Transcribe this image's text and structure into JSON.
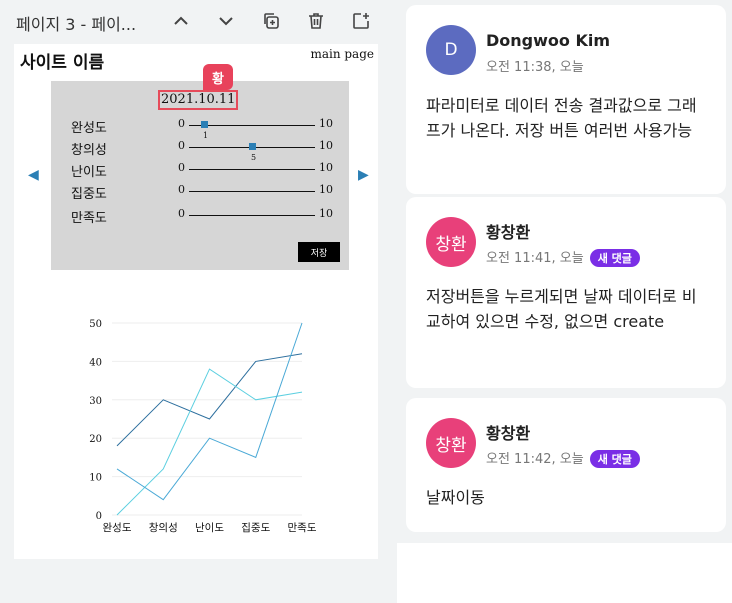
{
  "toolbar": {
    "page_title": "페이지 3 - 페이...",
    "buttons": [
      "chevron-up",
      "chevron-down",
      "duplicate-page",
      "delete-page",
      "add-page"
    ]
  },
  "wireframe": {
    "site_name": "사이트 이름",
    "main_page_link": "main page",
    "date": "2021.10.11",
    "cursor_tag": "황",
    "sliders": [
      {
        "label": "완성도",
        "min": "0",
        "max": "10",
        "value": "1"
      },
      {
        "label": "창의성",
        "min": "0",
        "max": "10",
        "value": "5"
      },
      {
        "label": "난이도",
        "min": "0",
        "max": "10",
        "value": ""
      },
      {
        "label": "집중도",
        "min": "0",
        "max": "10",
        "value": ""
      },
      {
        "label": "만족도",
        "min": "0",
        "max": "10",
        "value": ""
      }
    ],
    "save_label": "저장"
  },
  "chart_data": {
    "type": "line",
    "categories": [
      "완성도",
      "창의성",
      "난이도",
      "집중도",
      "만족도"
    ],
    "ylim": [
      0,
      50
    ],
    "yticks": [
      "0",
      "10",
      "20",
      "30",
      "40",
      "50"
    ],
    "grid": true,
    "series": [
      {
        "color": "#2d6f9e",
        "values": [
          18,
          30,
          25,
          40,
          42
        ]
      },
      {
        "color": "#5ccfe0",
        "values": [
          0,
          12,
          38,
          30,
          32
        ]
      },
      {
        "color": "#4aa9d6",
        "values": [
          12,
          4,
          20,
          15,
          50
        ]
      }
    ]
  },
  "comments": [
    {
      "avatar_text": "D",
      "avatar_color": "#5c6bc0",
      "author": "Dongwoo Kim",
      "time": "오전 11:38, 오늘",
      "badge": "",
      "text": "파라미터로 데이터 전송 결과값으로 그래프가 나온다. 저장 버튼 여러번 사용가능"
    },
    {
      "avatar_text": "창환",
      "avatar_color": "#e8407a",
      "author": "황창환",
      "time": "오전 11:41, 오늘",
      "badge": "새 댓글",
      "text": "저장버튼을 누르게되면 날짜 데이터로 비교하여 있으면 수정, 없으면 create"
    },
    {
      "avatar_text": "창환",
      "avatar_color": "#e8407a",
      "author": "황창환",
      "time": "오전 11:42, 오늘",
      "badge": "새 댓글",
      "text": "날짜이동"
    }
  ]
}
